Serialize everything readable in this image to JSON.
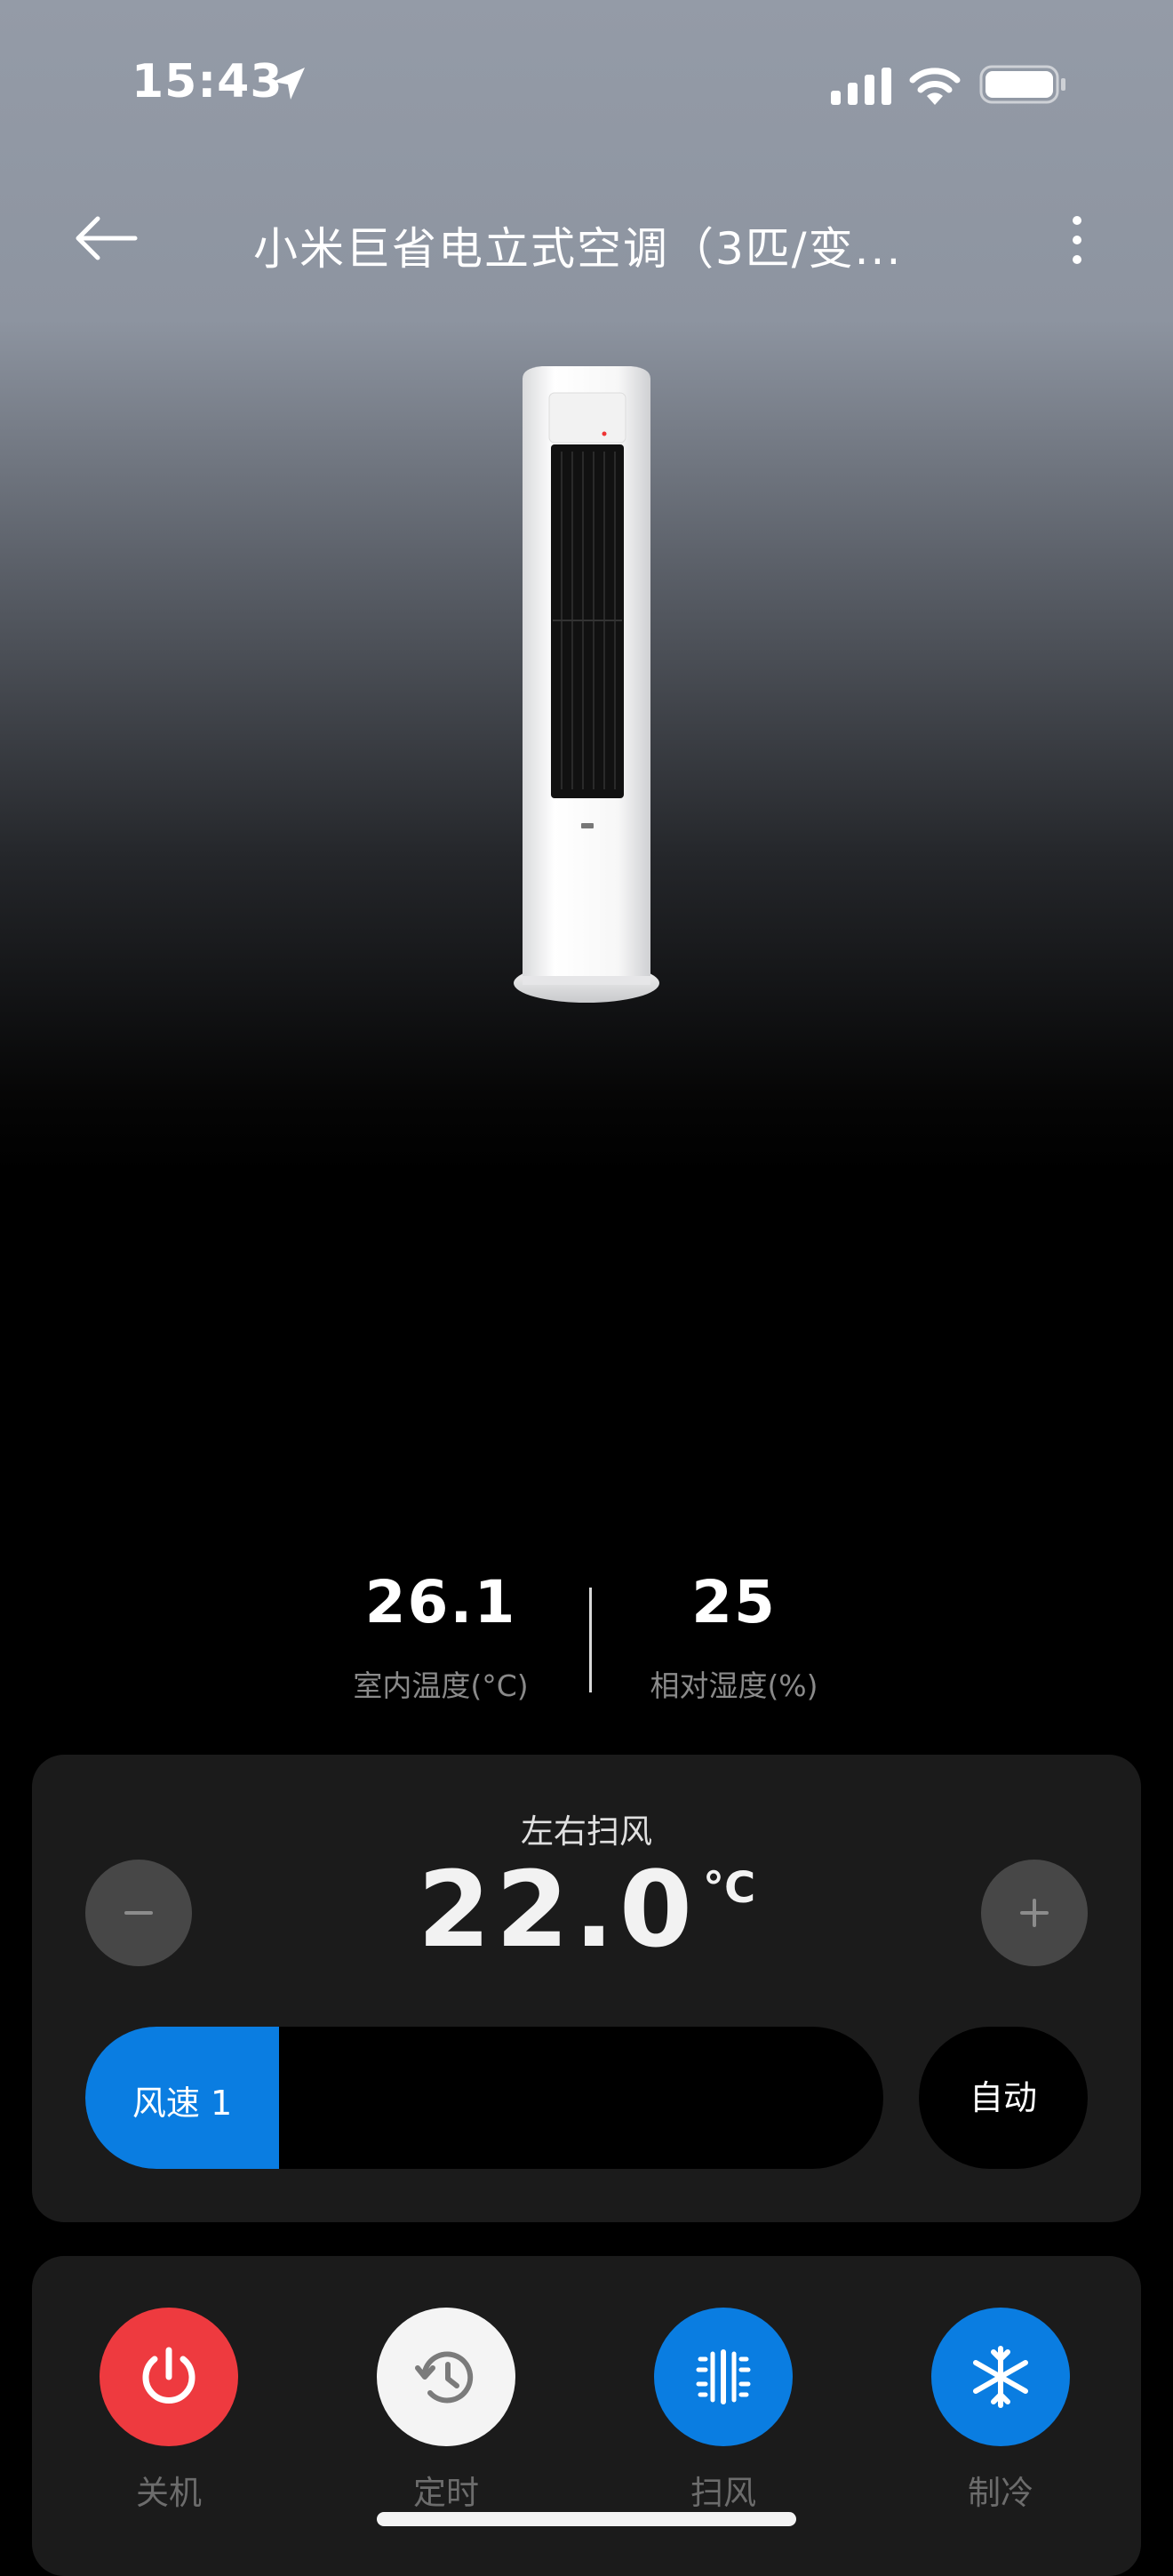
{
  "status_bar": {
    "time": "15:43",
    "location_icon": "location-arrow-icon",
    "signal_icon": "cellular-signal-icon",
    "wifi_icon": "wifi-icon",
    "battery_icon": "battery-icon"
  },
  "header": {
    "back_icon": "back-arrow-icon",
    "title": "小米巨省电立式空调（3匹/变...",
    "more_icon": "more-vertical-icon"
  },
  "readings": {
    "indoor_temp": {
      "value": "26.1",
      "label": "室内温度(°C)"
    },
    "humidity": {
      "value": "25",
      "label": "相对湿度(%)"
    }
  },
  "control": {
    "mode_label": "左右扫风",
    "target_temp": "22.0",
    "temp_unit": "°C",
    "minus_icon": "minus-icon",
    "plus_icon": "plus-icon",
    "fan_speed_label": "风速 1",
    "fan_speed_fill_fraction": 0.243,
    "auto_label": "自动"
  },
  "functions": [
    {
      "label": "关机",
      "icon": "power-icon",
      "color": "#ee3a3f"
    },
    {
      "label": "定时",
      "icon": "timer-icon",
      "color": "#f4f4f4"
    },
    {
      "label": "扫风",
      "icon": "swing-icon",
      "color": "#0a7de1"
    },
    {
      "label": "制冷",
      "icon": "snowflake-icon",
      "color": "#0a7de1"
    }
  ],
  "colors": {
    "accent_blue": "#0a7de1",
    "power_red": "#ee3a3f",
    "card_bg": "#1b1b1b"
  }
}
